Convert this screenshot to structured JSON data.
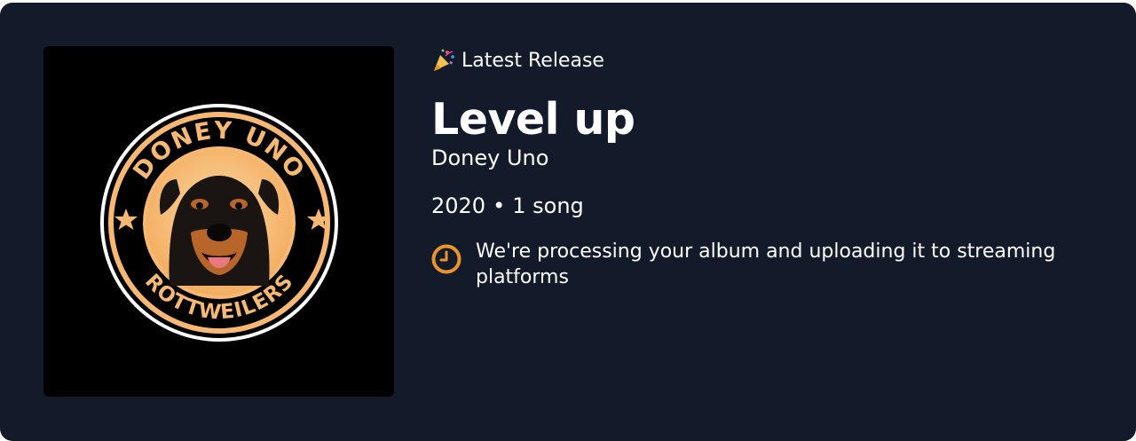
{
  "release": {
    "eyebrow_label": "Latest Release",
    "eyebrow_icon": "party-popper-icon",
    "title": "Level up",
    "artist": "Doney Uno",
    "year": "2020",
    "separator": "•",
    "song_count": "1 song",
    "status_icon": "clock-icon",
    "status_message": "We're processing your album and uploading it to streaming platforms"
  },
  "cover_art": {
    "top_text": "DONEY UNO",
    "bottom_text": "ROTTWEILERS"
  },
  "colors": {
    "card_background": "#131a2a",
    "accent_orange": "#e8952a",
    "badge_peach": "#f6b873"
  }
}
